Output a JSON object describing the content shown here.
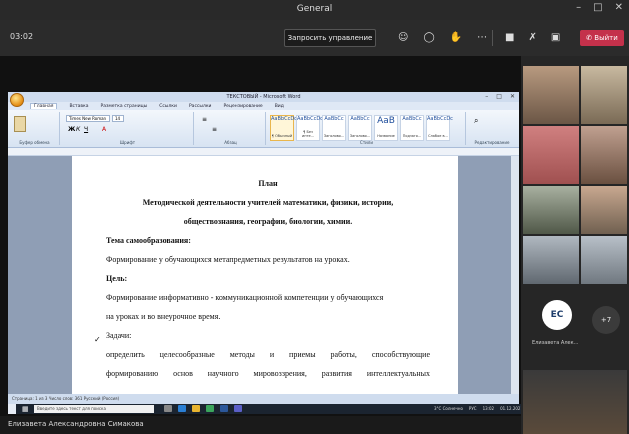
{
  "window": {
    "title": "General",
    "controls": [
      "–",
      "□",
      "✕"
    ]
  },
  "toolbar": {
    "timer": "03:02",
    "request_control": "Запросить управление",
    "leave": "Выйти",
    "icons": [
      "people-icon",
      "chat-icon",
      "reactions-icon",
      "more-icon"
    ],
    "media_icons": [
      "camera-icon",
      "mic-off-icon",
      "share-icon"
    ]
  },
  "word": {
    "title": "ТЕКСТОВЫЙ - Microsoft Word",
    "tabs": [
      "Главная",
      "Вставка",
      "Разметка страницы",
      "Ссылки",
      "Рассылки",
      "Рецензирование",
      "Вид"
    ],
    "active_tab": "Главная",
    "font_name": "Times New Roman",
    "font_size": "14",
    "ribbon_groups": [
      "Буфер обмена",
      "Шрифт",
      "Абзац",
      "Стили",
      "Редактирование"
    ],
    "styles": [
      {
        "sample": "AaBbCcDc",
        "name": "¶ Обычный"
      },
      {
        "sample": "AaBbCcDc",
        "name": "¶ Без инте..."
      },
      {
        "sample": "AaBbCc",
        "name": "Заголово..."
      },
      {
        "sample": "AaBbCc",
        "name": "Заголово..."
      },
      {
        "sample": "AaB",
        "name": "Название"
      },
      {
        "sample": "AaBbCc",
        "name": "Подзаго..."
      },
      {
        "sample": "AaBbCcDc",
        "name": "Слабое в..."
      }
    ],
    "status": "Страница: 1 из 3   Число слов: 361   Русский (Россия)"
  },
  "document": {
    "heading": "План",
    "subtitle_1": "Методической деятельности учителей математики, физики, истории,",
    "subtitle_2": "обществознания, географии, биологии, химии.",
    "topic_label": "Тема самообразования:",
    "topic_text": "Формирование у обучающихся метапредметных результатов на уроках.",
    "goal_label": "Цель:",
    "goal_text_1": "Формирование информативно - коммуникационной компетенции у обучающихся",
    "goal_text_2": "на уроках и во внеурочное время.",
    "tasks_label": "Задачи:",
    "task_1_line_1": "определить целесообразные методы и приемы работы, способствующие",
    "task_1_line_2": "формированию основ научного мировоззрения, развития интеллектуальных"
  },
  "taskbar": {
    "search_placeholder": "Введите здесь текст для поиска",
    "weather": "3°C Солнечно",
    "lang": "РУС",
    "time": "13:02",
    "date": "01.12.2021"
  },
  "presenter": {
    "name": "Елизавета Александровна Симакова"
  },
  "participants": {
    "avatar_initials": "ЕС",
    "avatar_name": "Елизавета Алек...",
    "more_count": "+7"
  },
  "colors": {
    "leave": "#c4314b",
    "toolbar": "#2b2b2b",
    "word_bg": "#e6ecf5"
  }
}
